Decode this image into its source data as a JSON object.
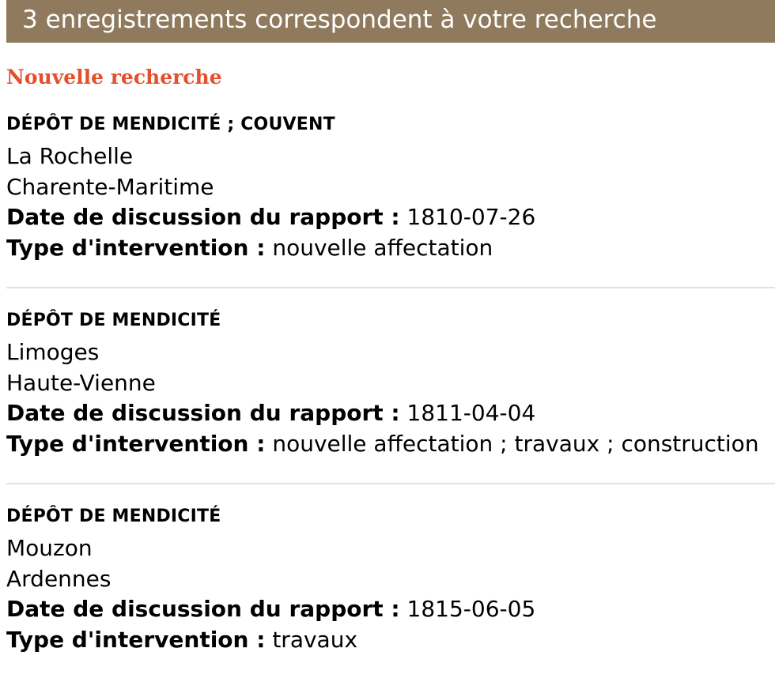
{
  "results_header": "3 enregistrements correspondent à votre recherche",
  "new_search_label": "Nouvelle recherche",
  "colors": {
    "header_background": "#8f7a5d",
    "header_text": "#ffffff",
    "link": "#e2502c",
    "separator": "#e6dfd6"
  },
  "labels": {
    "date": "Date de discussion du rapport :",
    "intervention": "Type d'intervention :"
  },
  "records": [
    {
      "type": "DÉPÔT DE MENDICITÉ ; COUVENT",
      "city": "La Rochelle",
      "department": "Charente-Maritime",
      "date": "1810-07-26",
      "intervention": "nouvelle affectation"
    },
    {
      "type": "DÉPÔT DE MENDICITÉ",
      "city": "Limoges",
      "department": "Haute-Vienne",
      "date": "1811-04-04",
      "intervention": "nouvelle affectation ; travaux ; construction"
    },
    {
      "type": "DÉPÔT DE MENDICITÉ",
      "city": "Mouzon",
      "department": "Ardennes",
      "date": "1815-06-05",
      "intervention": "travaux"
    }
  ]
}
